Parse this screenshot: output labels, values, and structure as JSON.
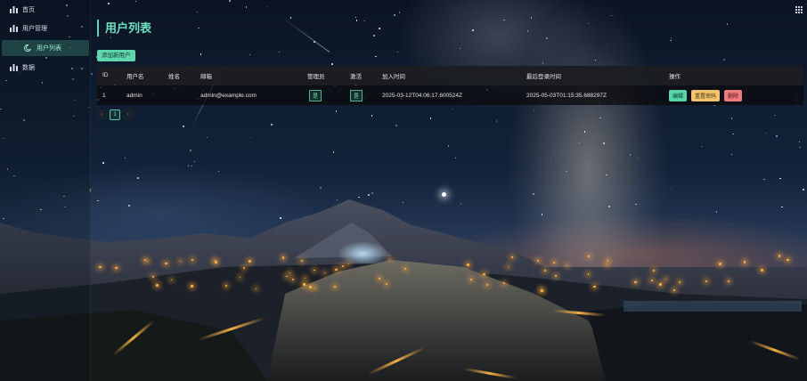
{
  "sidebar": {
    "items": [
      {
        "label": "首页",
        "icon": "bar-chart-icon"
      },
      {
        "label": "用户管理",
        "icon": "bar-chart-icon",
        "expanded": true
      },
      {
        "label": "用户列表",
        "icon": "moon-icon",
        "active": true
      },
      {
        "label": "数据",
        "icon": "bar-chart-icon",
        "expanded": false
      }
    ]
  },
  "main": {
    "title": "用户列表",
    "add_button": "添加新用户",
    "table": {
      "columns": [
        "ID",
        "用户名",
        "姓名",
        "邮箱",
        "管理员",
        "激活",
        "加入时间",
        "最后登录时间",
        "操作"
      ],
      "rows": [
        {
          "id": "1",
          "username": "admin",
          "name": "",
          "email": "admin@example.com",
          "admin": "是",
          "active": "是",
          "joined": "2025-03-12T04:06:17.600524Z",
          "last_login": "2025-05-03T01:15:35.688297Z",
          "actions": [
            "编辑",
            "重置密码",
            "删除"
          ]
        }
      ]
    },
    "pagination": {
      "prev": "‹",
      "current": "1",
      "next": "›"
    }
  },
  "colors": {
    "accent": "#5fd6ae",
    "warning": "#f1c36f",
    "danger": "#ee7b7d"
  }
}
